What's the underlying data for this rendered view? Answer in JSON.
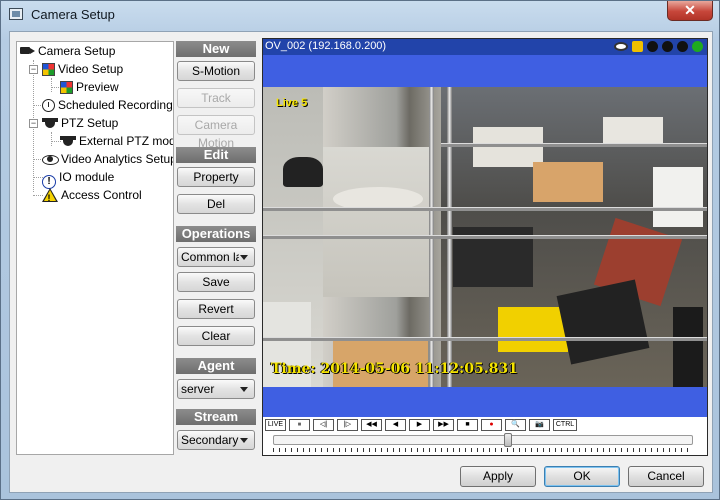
{
  "window": {
    "title": "Camera Setup",
    "close_glyph": "✕"
  },
  "tree": {
    "items": [
      {
        "label": "Camera Setup",
        "icon": "camera-icon"
      },
      {
        "label": "Video Setup",
        "icon": "video-setup-icon"
      },
      {
        "label": "Preview",
        "icon": "preview-icon"
      },
      {
        "label": "Scheduled Recording",
        "icon": "clock-icon"
      },
      {
        "label": "PTZ Setup",
        "icon": "ptz-camera-icon"
      },
      {
        "label": "External PTZ mod",
        "icon": "ptz-camera-icon"
      },
      {
        "label": "Video Analytics Setup",
        "icon": "eye-icon"
      },
      {
        "label": "IO module",
        "icon": "info-icon"
      },
      {
        "label": "Access Control",
        "icon": "warning-icon"
      }
    ]
  },
  "panel": {
    "new_header": "New",
    "smotion_label": "S-Motion",
    "track_label": "Track",
    "camera_motion_label": "Camera Motion",
    "edit_header": "Edit",
    "property_label": "Property",
    "del_label": "Del",
    "operations_header": "Operations",
    "layout_value": "Common lay",
    "save_label": "Save",
    "revert_label": "Revert",
    "clear_label": "Clear",
    "agent_header": "Agent",
    "agent_value": "server",
    "stream_header": "Stream",
    "stream_value": "Secondary"
  },
  "video": {
    "title": "OV_002 (192.168.0.200)",
    "live_overlay": "Live 5",
    "time_overlay": "Time: 2014-05-06 11:12:05.831",
    "status_colors": [
      "#111111",
      "#111111",
      "#111111",
      "#1faa1f"
    ],
    "controls": {
      "live": "LIVE",
      "pause": "⏸",
      "step_back": "◁|",
      "step_forward": "|▷",
      "rewind": "◀◀",
      "prev": "◀",
      "play": "▶",
      "fast_forward": "▶▶",
      "stop": "■",
      "record": "●",
      "search": "🔍",
      "snapshot": "📷",
      "ctrl": "CTRL"
    },
    "playback_position": 0.56
  },
  "footer": {
    "apply_label": "Apply",
    "ok_label": "OK",
    "cancel_label": "Cancel"
  }
}
